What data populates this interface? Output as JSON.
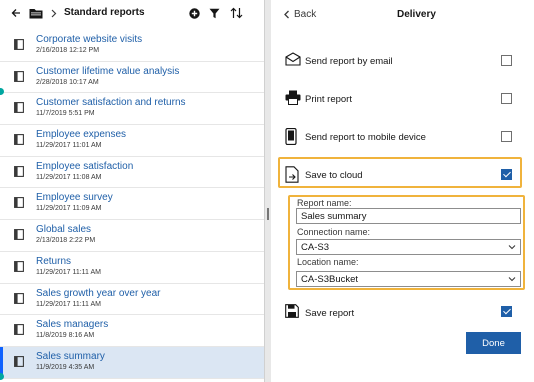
{
  "toolbar": {
    "breadcrumb": "Standard reports",
    "icons": [
      "back-arrow-icon",
      "folder-icon",
      "chevron-right-icon",
      "add-icon",
      "filter-icon",
      "sort-icon"
    ]
  },
  "reports": [
    {
      "name": "Corporate website visits",
      "date": "2/16/2018 12:12 PM"
    },
    {
      "name": "Customer lifetime value analysis",
      "date": "2/28/2018 10:17 AM"
    },
    {
      "name": "Customer satisfaction and returns",
      "date": "11/7/2019 5:51 PM"
    },
    {
      "name": "Employee expenses",
      "date": "11/29/2017 11:01 AM"
    },
    {
      "name": "Employee satisfaction",
      "date": "11/29/2017 11:08 AM"
    },
    {
      "name": "Employee survey",
      "date": "11/29/2017 11:09 AM"
    },
    {
      "name": "Global sales",
      "date": "2/13/2018 2:22 PM"
    },
    {
      "name": "Returns",
      "date": "11/29/2017 11:11 AM"
    },
    {
      "name": "Sales growth year over year",
      "date": "11/29/2017 11:11 AM"
    },
    {
      "name": "Sales managers",
      "date": "11/8/2019 8:16 AM"
    },
    {
      "name": "Sales summary",
      "date": "11/9/2019 4:35 AM"
    }
  ],
  "selected_report": "Sales summary",
  "delivery": {
    "back_label": "Back",
    "title": "Delivery",
    "options": {
      "email": {
        "label": "Send report by email",
        "checked": false
      },
      "print": {
        "label": "Print report",
        "checked": false
      },
      "mobile": {
        "label": "Send report to mobile device",
        "checked": false
      },
      "cloud": {
        "label": "Save to cloud",
        "checked": true
      },
      "save": {
        "label": "Save report",
        "checked": true
      }
    },
    "report_name_label": "Report name:",
    "report_name_value": "Sales summary",
    "connection_label": "Connection name:",
    "connection_value": "CA-S3",
    "location_label": "Location name:",
    "location_value": "CA-S3Bucket",
    "done_label": "Done"
  },
  "colors": {
    "link": "#1f5fa8",
    "primary": "#1f5fa8",
    "highlight": "#f0b33c",
    "selected_row": "#dbe6f3",
    "marker": "#00a6a0"
  }
}
